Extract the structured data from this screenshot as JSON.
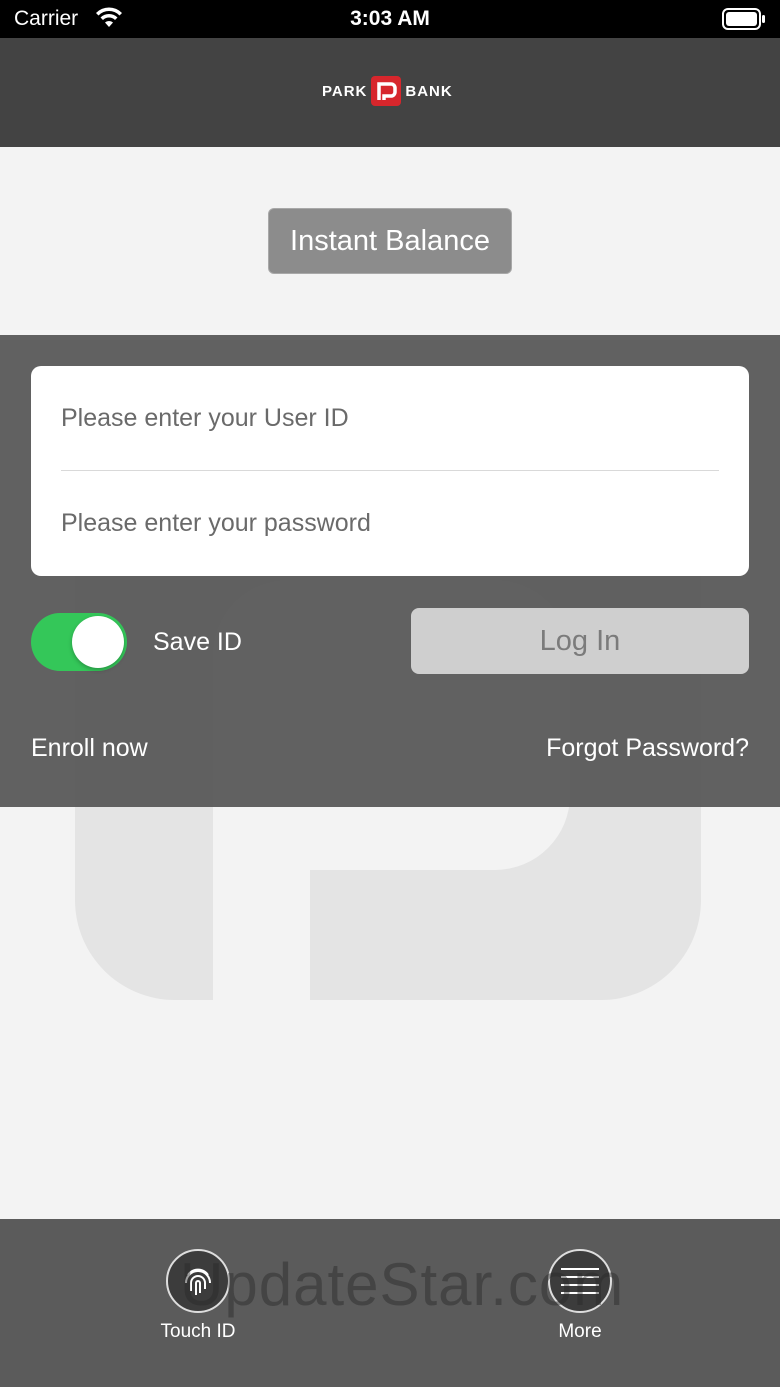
{
  "status_bar": {
    "carrier": "Carrier",
    "time": "3:03 AM"
  },
  "header": {
    "logo_left": "PARK",
    "logo_right": "BANK"
  },
  "instant_balance": {
    "label": "Instant Balance"
  },
  "login": {
    "user_id_placeholder": "Please enter your User ID",
    "password_placeholder": "Please enter your password",
    "save_id_label": "Save ID",
    "save_id_on": true,
    "login_label": "Log In",
    "enroll_label": "Enroll now",
    "forgot_label": "Forgot Password?"
  },
  "bottom_nav": {
    "touch_id_label": "Touch ID",
    "more_label": "More"
  },
  "watermark": "UpdateStar.com",
  "colors": {
    "header_bg": "#434343",
    "brand_red": "#d7262c",
    "toggle_on": "#34c759",
    "panel_bg": "#555555"
  }
}
